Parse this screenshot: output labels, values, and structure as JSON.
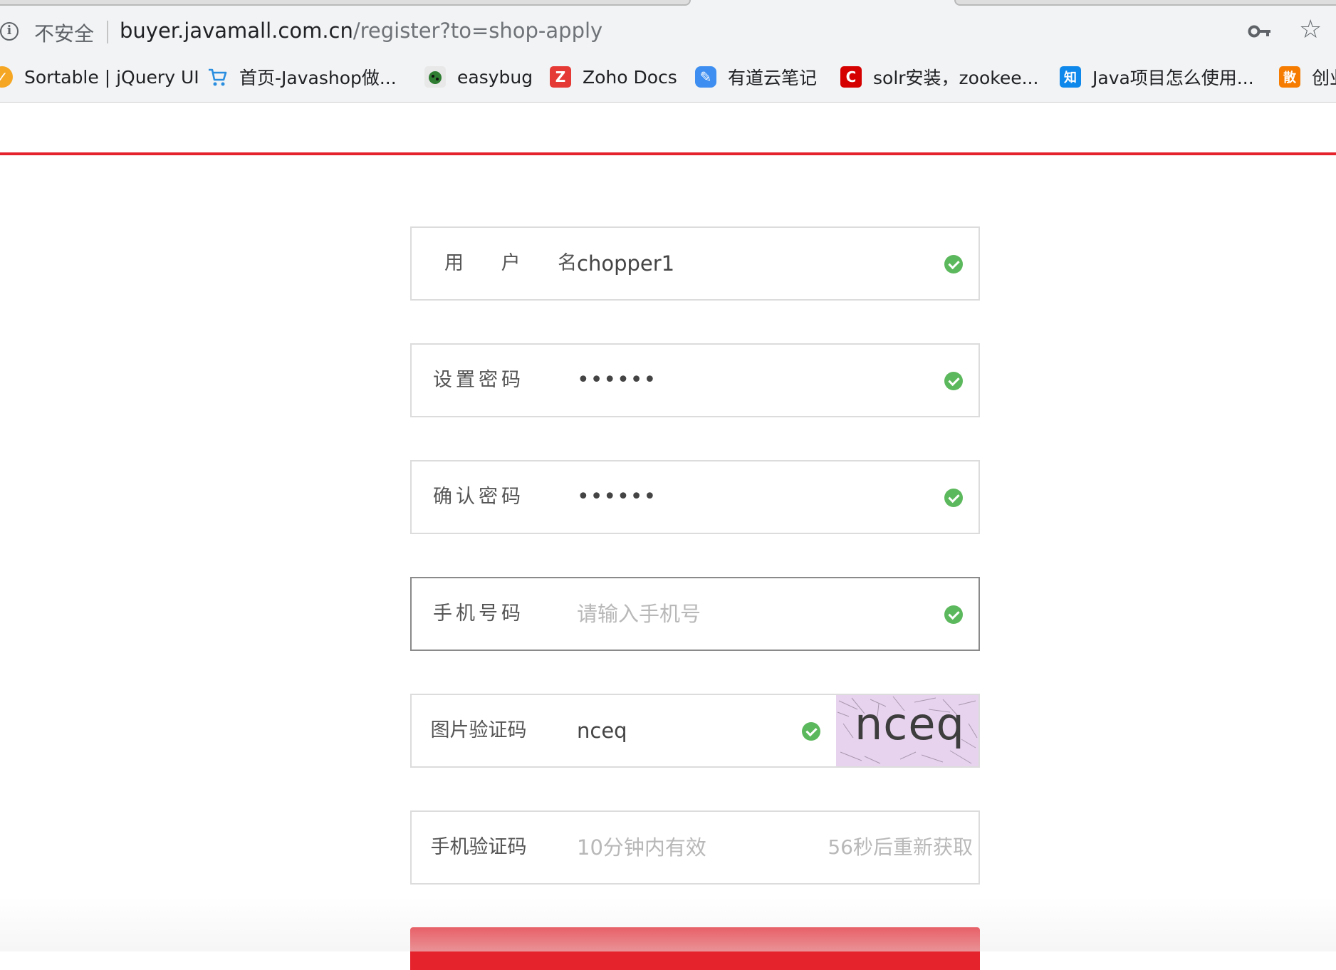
{
  "browser": {
    "security_label": "不安全",
    "url_host": "buyer.javamall.com.cn",
    "url_path": "/register?to=shop-apply",
    "bookmarks": [
      {
        "label": "Sortable | jQuery UI",
        "icon": "jquery-icon",
        "color": "#f5a623"
      },
      {
        "label": "首页-Javashop做...",
        "icon": "cart-icon",
        "color": "#2a8ee0"
      },
      {
        "label": "easybug",
        "icon": "bug-icon",
        "color": "#2e7d32"
      },
      {
        "label": "Zoho Docs",
        "icon": "zoho-icon",
        "color": "#e53935"
      },
      {
        "label": "有道云笔记",
        "icon": "youdao-note-icon",
        "color": "#3d8ef0"
      },
      {
        "label": "solr安装，zookee...",
        "icon": "csdn-icon",
        "color": "#d50000"
      },
      {
        "label": "Java项目怎么使用...",
        "icon": "zhihu-icon",
        "color": "#0f88eb"
      },
      {
        "label": "创业",
        "icon": "bookmark-icon",
        "color": "#f57c00"
      }
    ]
  },
  "form": {
    "username": {
      "label": "用 户 名",
      "value": "chopper1"
    },
    "password": {
      "label": "设置密码",
      "value": "••••••"
    },
    "confirm_password": {
      "label": "确认密码",
      "value": "••••••"
    },
    "phone": {
      "label": "手机号码",
      "placeholder": "请输入手机号"
    },
    "image_captcha": {
      "label": "图片验证码",
      "value": "nceq",
      "captcha_text": "nceq"
    },
    "sms_code": {
      "label": "手机验证码",
      "placeholder": "10分钟内有效",
      "resend": "56秒后重新获取"
    }
  },
  "colors": {
    "accent": "#e4232d",
    "valid": "#5cb85c",
    "captcha_bg": "#e7d3ee"
  }
}
